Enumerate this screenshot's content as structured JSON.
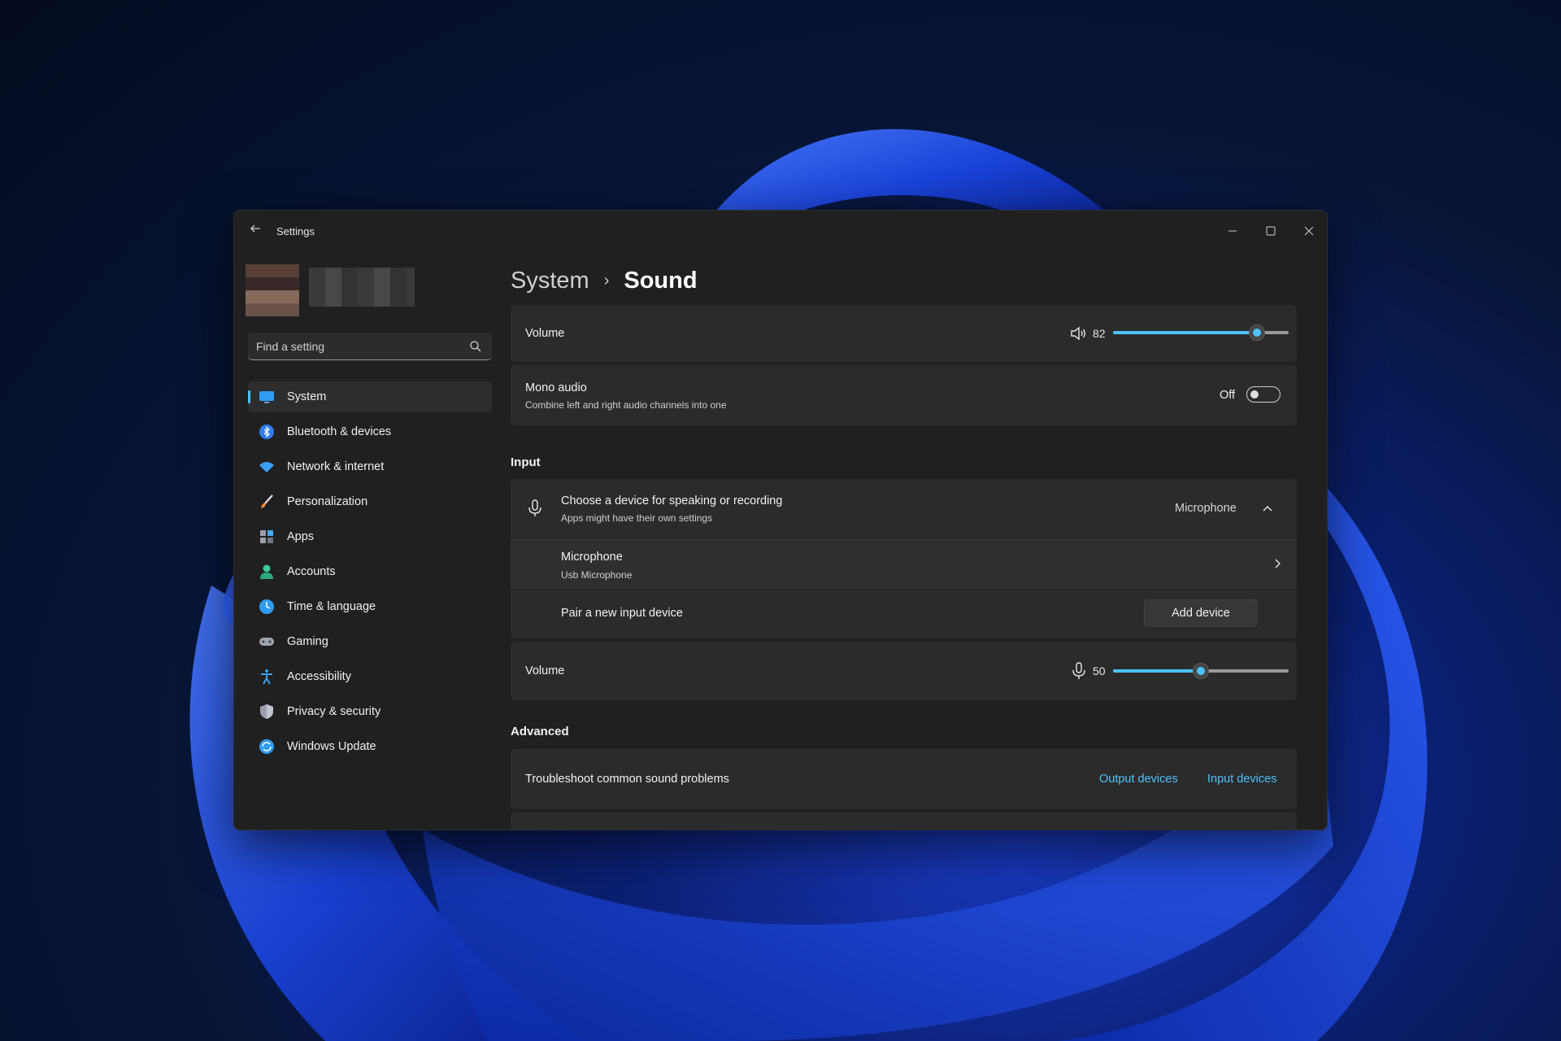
{
  "window": {
    "app_title": "Settings",
    "controls": [
      "minimize-icon",
      "maximize-icon",
      "close-icon"
    ]
  },
  "sidebar": {
    "search_placeholder": "Find a setting",
    "items": [
      {
        "label": "System",
        "icon": "system-display-icon",
        "active": true
      },
      {
        "label": "Bluetooth & devices",
        "icon": "bluetooth-icon",
        "active": false
      },
      {
        "label": "Network & internet",
        "icon": "wifi-icon",
        "active": false
      },
      {
        "label": "Personalization",
        "icon": "brush-icon",
        "active": false
      },
      {
        "label": "Apps",
        "icon": "apps-icon",
        "active": false
      },
      {
        "label": "Accounts",
        "icon": "person-icon",
        "active": false
      },
      {
        "label": "Time & language",
        "icon": "clock-globe-icon",
        "active": false
      },
      {
        "label": "Gaming",
        "icon": "gamepad-icon",
        "active": false
      },
      {
        "label": "Accessibility",
        "icon": "accessibility-icon",
        "active": false
      },
      {
        "label": "Privacy & security",
        "icon": "shield-icon",
        "active": false
      },
      {
        "label": "Windows Update",
        "icon": "update-icon",
        "active": false
      }
    ]
  },
  "breadcrumb": {
    "parent": "System",
    "separator": "›",
    "current": "Sound"
  },
  "output_volume": {
    "label": "Volume",
    "value": "82",
    "level": 0.82,
    "icon": "speaker-icon"
  },
  "mono_audio": {
    "title": "Mono audio",
    "subtitle": "Combine left and right audio channels into one",
    "state_label": "Off",
    "on": false
  },
  "input_section": {
    "heading": "Input",
    "choose_device": {
      "title": "Choose a device for speaking or recording",
      "subtitle": "Apps might have their own settings",
      "selected": "Microphone",
      "icon": "microphone-icon"
    },
    "device": {
      "name": "Microphone",
      "detail": "Usb Microphone"
    },
    "pair": {
      "label": "Pair a new input device",
      "button": "Add device"
    },
    "volume": {
      "label": "Volume",
      "value": "50",
      "level": 0.5,
      "icon": "microphone-icon"
    }
  },
  "advanced_section": {
    "heading": "Advanced",
    "troubleshoot": {
      "label": "Troubleshoot common sound problems",
      "links": [
        "Output devices",
        "Input devices"
      ]
    }
  },
  "colors": {
    "accent": "#4cc2ff",
    "window_bg": "#202020",
    "card_bg": "#2b2b2b"
  }
}
